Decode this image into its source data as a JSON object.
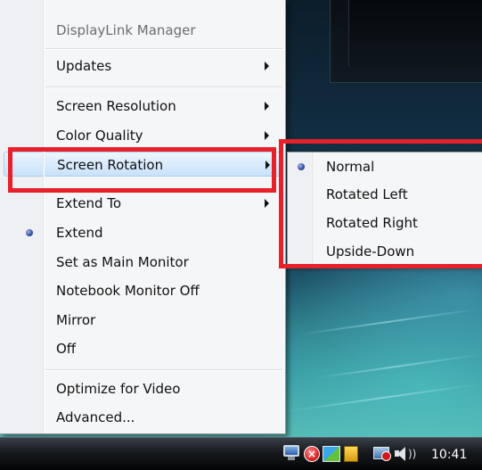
{
  "menu": {
    "items": [
      {
        "label": "DisplayLink Manager",
        "disabled": true
      },
      {
        "label": "Updates",
        "submenu": true
      },
      {
        "label": "Screen Resolution",
        "submenu": true
      },
      {
        "label": "Color Quality",
        "submenu": true
      },
      {
        "label": "Screen Rotation",
        "submenu": true,
        "highlighted": true
      },
      {
        "label": "Extend To",
        "submenu": true
      },
      {
        "label": "Extend",
        "selected": true
      },
      {
        "label": "Set as Main Monitor"
      },
      {
        "label": "Notebook Monitor Off"
      },
      {
        "label": "Mirror"
      },
      {
        "label": "Off"
      },
      {
        "label": "Optimize for Video"
      },
      {
        "label": "Advanced..."
      }
    ]
  },
  "submenu": {
    "parent": "Screen Rotation",
    "items": [
      {
        "label": "Normal",
        "selected": true
      },
      {
        "label": "Rotated Left"
      },
      {
        "label": "Rotated Right"
      },
      {
        "label": "Upside-Down"
      }
    ]
  },
  "annotations": {
    "color": "#e8202a"
  },
  "taskbar": {
    "clock": "10:41",
    "tray_icons": [
      "monitor-icon",
      "error-icon",
      "displaylink-icon",
      "warning-icon",
      "network-icon",
      "volume-icon"
    ]
  },
  "colors": {
    "highlight": "#c9e2fa",
    "radio": "#3a52a8"
  }
}
